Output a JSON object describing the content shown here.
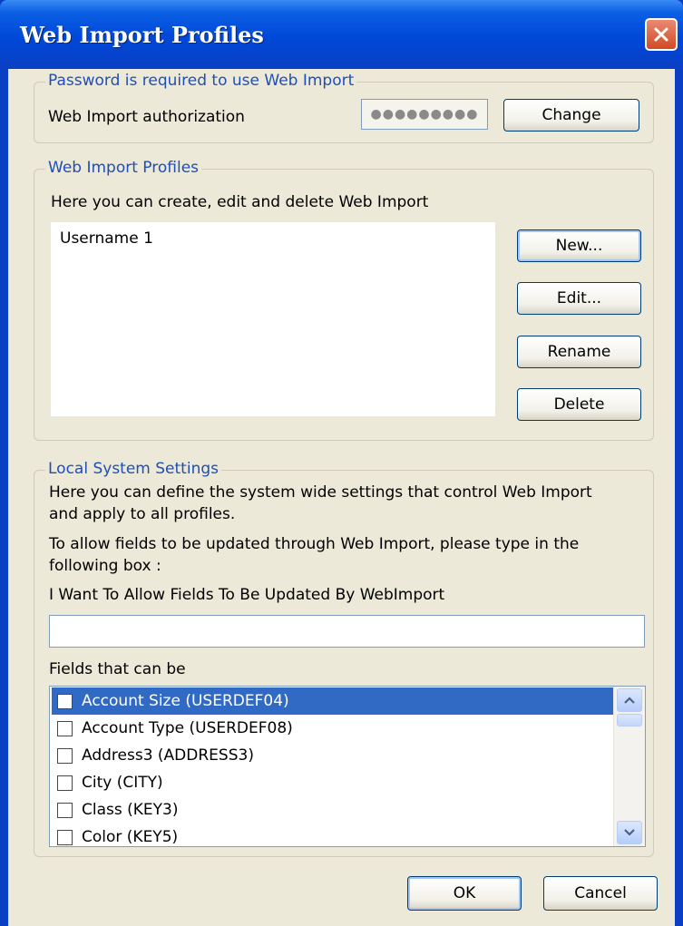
{
  "window": {
    "title": "Web Import Profiles",
    "close_icon": "close-icon"
  },
  "password_group": {
    "legend": "Password is required to use Web Import",
    "auth_label": "Web Import authorization",
    "password_mask": "●●●●●●●●●",
    "change_label": "Change"
  },
  "profiles_group": {
    "legend": "Web Import Profiles",
    "description": "Here you can create, edit and delete Web Import",
    "items": [
      "Username 1"
    ],
    "new_label": "New...",
    "edit_label": "Edit...",
    "rename_label": "Rename",
    "delete_label": "Delete"
  },
  "local_group": {
    "legend": "Local System Settings",
    "desc_line1": "Here you can define the system wide settings that control Web Import",
    "desc_line2": "and apply to all profiles.",
    "allow_line1": "To allow fields to be updated through Web Import, please type in the",
    "allow_line2": "following box :",
    "phrase": "I Want To Allow Fields To Be Updated By WebImport",
    "confirm_input_value": "",
    "fields_label": "Fields that can be",
    "fields": [
      {
        "label": "Account Size (USERDEF04)",
        "checked": false,
        "selected": true
      },
      {
        "label": "Account Type (USERDEF08)",
        "checked": false,
        "selected": false
      },
      {
        "label": "Address3 (ADDRESS3)",
        "checked": false,
        "selected": false
      },
      {
        "label": "City (CITY)",
        "checked": false,
        "selected": false
      },
      {
        "label": "Class (KEY3)",
        "checked": false,
        "selected": false
      },
      {
        "label": "Color (KEY5)",
        "checked": false,
        "selected": false
      }
    ]
  },
  "footer": {
    "ok_label": "OK",
    "cancel_label": "Cancel"
  },
  "colors": {
    "title_bar": "#0a3fc4",
    "dialog_bg": "#ece9d8",
    "legend_text": "#1f4fb4",
    "selection": "#316ac5"
  }
}
